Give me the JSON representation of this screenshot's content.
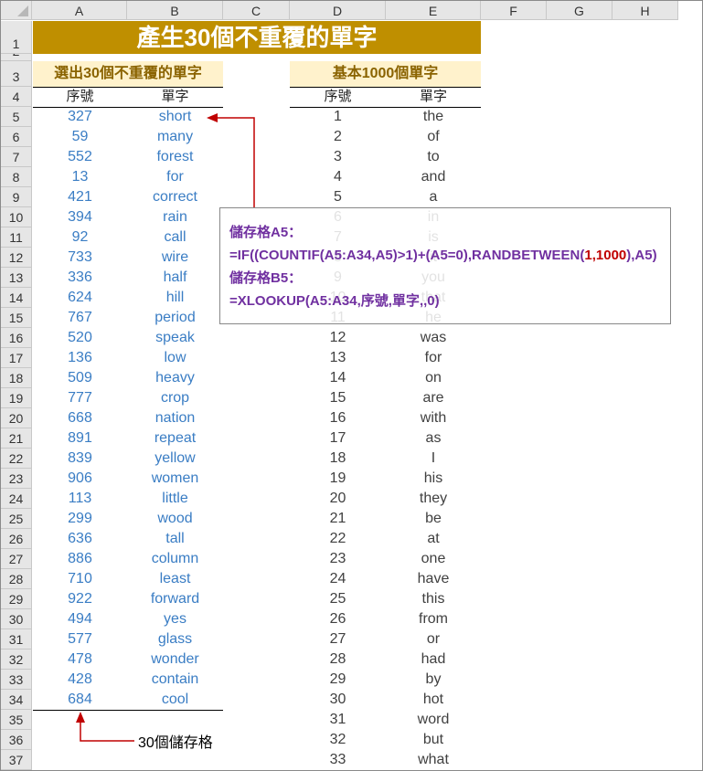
{
  "columns": [
    "A",
    "B",
    "C",
    "D",
    "E",
    "F",
    "G",
    "H"
  ],
  "title": "產生30個不重覆的單字",
  "left_table": {
    "header": "選出30個不重覆的單字",
    "col_seq": "序號",
    "col_word": "單字",
    "rows": [
      [
        327,
        "short"
      ],
      [
        59,
        "many"
      ],
      [
        552,
        "forest"
      ],
      [
        13,
        "for"
      ],
      [
        421,
        "correct"
      ],
      [
        394,
        "rain"
      ],
      [
        92,
        "call"
      ],
      [
        733,
        "wire"
      ],
      [
        336,
        "half"
      ],
      [
        624,
        "hill"
      ],
      [
        767,
        "period"
      ],
      [
        520,
        "speak"
      ],
      [
        136,
        "low"
      ],
      [
        509,
        "heavy"
      ],
      [
        777,
        "crop"
      ],
      [
        668,
        "nation"
      ],
      [
        891,
        "repeat"
      ],
      [
        839,
        "yellow"
      ],
      [
        906,
        "women"
      ],
      [
        113,
        "little"
      ],
      [
        299,
        "wood"
      ],
      [
        636,
        "tall"
      ],
      [
        886,
        "column"
      ],
      [
        710,
        "least"
      ],
      [
        922,
        "forward"
      ],
      [
        494,
        "yes"
      ],
      [
        577,
        "glass"
      ],
      [
        478,
        "wonder"
      ],
      [
        428,
        "contain"
      ],
      [
        684,
        "cool"
      ]
    ]
  },
  "right_table": {
    "header": "基本1000個單字",
    "col_seq": "序號",
    "col_word": "單字",
    "rows": [
      [
        1,
        "the"
      ],
      [
        2,
        "of"
      ],
      [
        3,
        "to"
      ],
      [
        4,
        "and"
      ],
      [
        5,
        "a"
      ],
      [
        6,
        "in"
      ],
      [
        7,
        "is"
      ],
      [
        8,
        "it"
      ],
      [
        9,
        "you"
      ],
      [
        10,
        "that"
      ],
      [
        11,
        "he"
      ],
      [
        12,
        "was"
      ],
      [
        13,
        "for"
      ],
      [
        14,
        "on"
      ],
      [
        15,
        "are"
      ],
      [
        16,
        "with"
      ],
      [
        17,
        "as"
      ],
      [
        18,
        "I"
      ],
      [
        19,
        "his"
      ],
      [
        20,
        "they"
      ],
      [
        21,
        "be"
      ],
      [
        22,
        "at"
      ],
      [
        23,
        "one"
      ],
      [
        24,
        "have"
      ],
      [
        25,
        "this"
      ],
      [
        26,
        "from"
      ],
      [
        27,
        "or"
      ],
      [
        28,
        "had"
      ],
      [
        29,
        "by"
      ],
      [
        30,
        "hot"
      ],
      [
        31,
        "word"
      ],
      [
        32,
        "but"
      ],
      [
        33,
        "what"
      ]
    ]
  },
  "formula_box": {
    "a5_label": "儲存格A5：",
    "a5_formula_1": "=IF((COUNTIF(A5:A34,A5)>1)+(A5=0),RANDBETWEEN(",
    "a5_formula_args": "1,1000",
    "a5_formula_2": "),A5)",
    "b5_label": "儲存格B5：",
    "b5_formula": "=XLOOKUP(A5:A34,序號,單字,,0)"
  },
  "note": "30個儲存格",
  "colors": {
    "title_fill": "#bf8f00",
    "subheader_fill": "#fff2cc",
    "value_blue": "#3a7dc4",
    "formula_purple": "#7030a0",
    "arrow_red": "#c00000"
  }
}
